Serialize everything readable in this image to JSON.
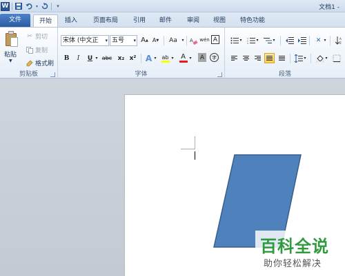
{
  "window": {
    "title": "文档1 -"
  },
  "qat": {
    "app_icon": "W"
  },
  "tabs": [
    {
      "label": "文件"
    },
    {
      "label": "开始"
    },
    {
      "label": "插入"
    },
    {
      "label": "页面布局"
    },
    {
      "label": "引用"
    },
    {
      "label": "邮件"
    },
    {
      "label": "审阅"
    },
    {
      "label": "视图"
    },
    {
      "label": "特色功能"
    }
  ],
  "clipboard": {
    "group_label": "剪贴板",
    "paste_label": "粘贴",
    "cut_label": "剪切",
    "copy_label": "复制",
    "format_painter_label": "格式刷"
  },
  "font": {
    "group_label": "字体",
    "font_name": "宋体 (中文正",
    "font_size": "五号",
    "bold": "B",
    "italic": "I",
    "underline": "U",
    "strikethrough": "abc",
    "subscript": "x₂",
    "superscript": "x²",
    "grow": "A",
    "shrink": "A",
    "change_case": "Aa",
    "phonetic": "wén",
    "char_border": "A",
    "text_effect": "A",
    "highlight": "ab",
    "font_color": "A",
    "char_shading": "A",
    "enclose": "字"
  },
  "paragraph": {
    "group_label": "段落"
  },
  "watermark": {
    "title": "百科全说",
    "subtitle": "助你轻松解决"
  },
  "colors": {
    "shape_fill": "#4f81bd",
    "shape_stroke": "#385d8a",
    "watermark_green": "#2f9a3e",
    "file_tab": "#2c5aa0"
  }
}
